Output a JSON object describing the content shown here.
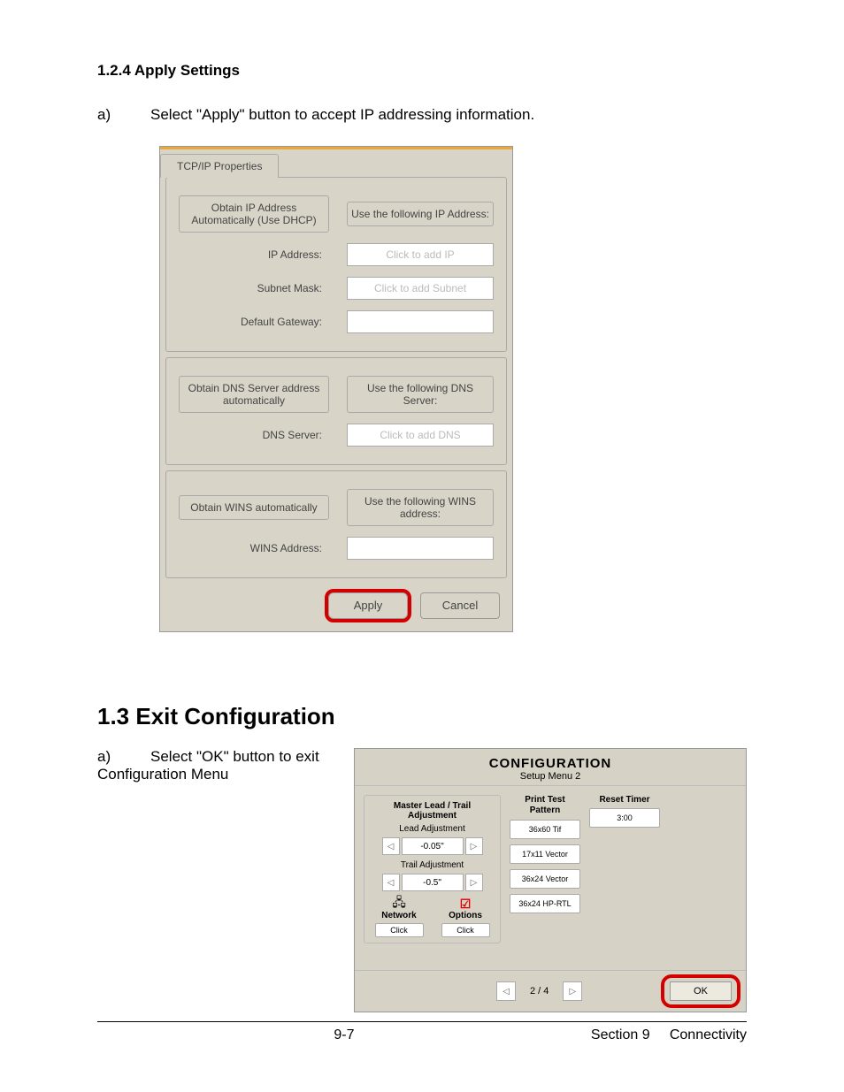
{
  "doc": {
    "heading_124": "1.2.4   Apply Settings",
    "step_a1": "Select \"Apply\" button to accept IP addressing information.",
    "heading_13": "1.3 Exit Configuration",
    "step_a2_1": "Select  \"OK\" button to exit",
    "step_a2_2": "Configuration Menu",
    "footer_page": "9-7",
    "footer_section": "Section 9     Connectivity"
  },
  "tcpip": {
    "tab": "TCP/IP Properties",
    "obtain_ip": "Obtain IP Address Automatically (Use DHCP)",
    "use_ip": "Use the following IP Address:",
    "ip_label": "IP Address:",
    "ip_ph": "Click to add IP",
    "subnet_label": "Subnet Mask:",
    "subnet_ph": "Click to add Subnet",
    "gateway_label": "Default Gateway:",
    "obtain_dns": "Obtain DNS Server address automatically",
    "use_dns": "Use the following DNS Server:",
    "dns_label": "DNS Server:",
    "dns_ph": "Click to add DNS",
    "obtain_wins": "Obtain WINS automatically",
    "use_wins": "Use the following WINS address:",
    "wins_label": "WINS Address:",
    "apply": "Apply",
    "cancel": "Cancel"
  },
  "config": {
    "title": "CONFIGURATION",
    "subtitle": "Setup Menu 2",
    "master": "Master Lead / Trail Adjustment",
    "lead_label": "Lead Adjustment",
    "lead_val": "-0.05\"",
    "trail_label": "Trail Adjustment",
    "trail_val": "-0.5\"",
    "network_label": "Network",
    "options_label": "Options",
    "click": "Click",
    "print_test": "Print Test Pattern",
    "pt1": "36x60 Tif",
    "pt2": "17x11 Vector",
    "pt3": "36x24 Vector",
    "pt4": "36x24 HP-RTL",
    "reset_timer": "Reset Timer",
    "timer_val": "3:00",
    "pager": "2 / 4",
    "ok": "OK"
  }
}
